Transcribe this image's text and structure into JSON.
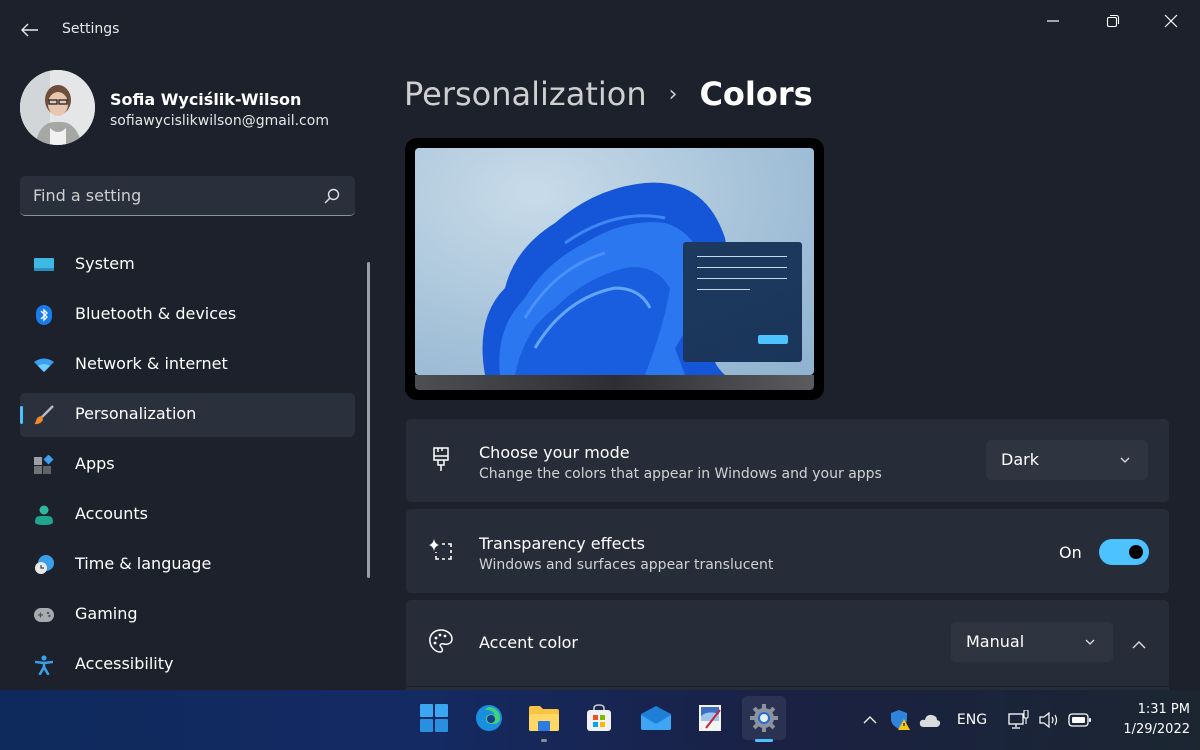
{
  "window": {
    "title": "Settings",
    "controls": {
      "minimize": "minimize",
      "maximize": "restore",
      "close": "close"
    }
  },
  "profile": {
    "name": "Sofia Wyciślik-Wilson",
    "email": "sofiawycislikwilson@gmail.com"
  },
  "search": {
    "placeholder": "Find a setting",
    "value": ""
  },
  "sidebar": {
    "items": [
      {
        "label": "System",
        "icon": "monitor-icon",
        "active": false
      },
      {
        "label": "Bluetooth & devices",
        "icon": "bluetooth-icon",
        "active": false
      },
      {
        "label": "Network & internet",
        "icon": "wifi-icon",
        "active": false
      },
      {
        "label": "Personalization",
        "icon": "paintbrush-icon",
        "active": true
      },
      {
        "label": "Apps",
        "icon": "apps-icon",
        "active": false
      },
      {
        "label": "Accounts",
        "icon": "person-icon",
        "active": false
      },
      {
        "label": "Time & language",
        "icon": "globe-clock-icon",
        "active": false
      },
      {
        "label": "Gaming",
        "icon": "gamepad-icon",
        "active": false
      },
      {
        "label": "Accessibility",
        "icon": "accessibility-icon",
        "active": false
      }
    ]
  },
  "breadcrumb": {
    "parent": "Personalization",
    "separator": "›",
    "current": "Colors"
  },
  "settings": {
    "mode": {
      "title": "Choose your mode",
      "description": "Change the colors that appear in Windows and your apps",
      "value": "Dark",
      "icon": "paint-brush-outline-icon"
    },
    "transparency": {
      "title": "Transparency effects",
      "description": "Windows and surfaces appear translucent",
      "state_label": "On",
      "enabled": true,
      "icon": "sparkle-dashed-square-icon"
    },
    "accent": {
      "title": "Accent color",
      "value": "Manual",
      "expanded": true,
      "icon": "palette-icon"
    }
  },
  "colors": {
    "accent": "#4cc2ff",
    "background": "#1c212b",
    "card": "#272d38"
  },
  "taskbar": {
    "apps": [
      {
        "name": "Start",
        "icon": "windows-start-icon",
        "running": false
      },
      {
        "name": "Microsoft Edge",
        "icon": "edge-icon",
        "running": false
      },
      {
        "name": "File Explorer",
        "icon": "folder-icon",
        "running": true
      },
      {
        "name": "Microsoft Store",
        "icon": "store-icon",
        "running": false
      },
      {
        "name": "Mail",
        "icon": "mail-icon",
        "running": false
      },
      {
        "name": "Paint",
        "icon": "paint-icon",
        "running": false
      },
      {
        "name": "Settings",
        "icon": "settings-gear-icon",
        "running": true,
        "active": true
      }
    ],
    "tray": {
      "language": "ENG",
      "time": "1:31 PM",
      "date": "1/29/2022"
    }
  }
}
